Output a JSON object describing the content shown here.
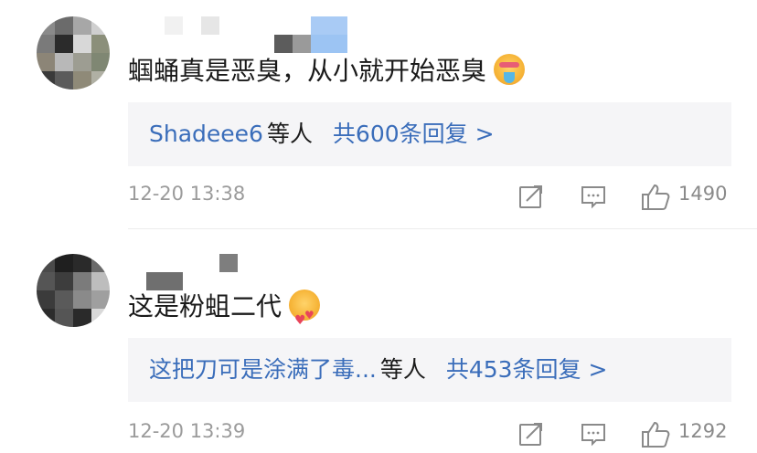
{
  "comments": [
    {
      "text": "蝈蛹真是恶臭，从小就开始恶臭",
      "emoji": "hot-face-icon",
      "reply_who": "Shadeee6",
      "reply_etc": "等人",
      "reply_count": "共600条回复 >",
      "time": "12-20 13:38",
      "likes": "1490"
    },
    {
      "text": "这是粉蛆二代",
      "emoji": "heart-face-icon",
      "reply_who": "这把刀可是涂满了毒...",
      "reply_etc": "等人",
      "reply_count": "共453条回复 >",
      "time": "12-20 13:39",
      "likes": "1292"
    }
  ],
  "colors": {
    "link": "#3a6dba",
    "meta": "#9b9b9b",
    "reply_bg": "#f5f5f7"
  },
  "icons": [
    "share-icon",
    "comment-icon",
    "like-icon"
  ]
}
